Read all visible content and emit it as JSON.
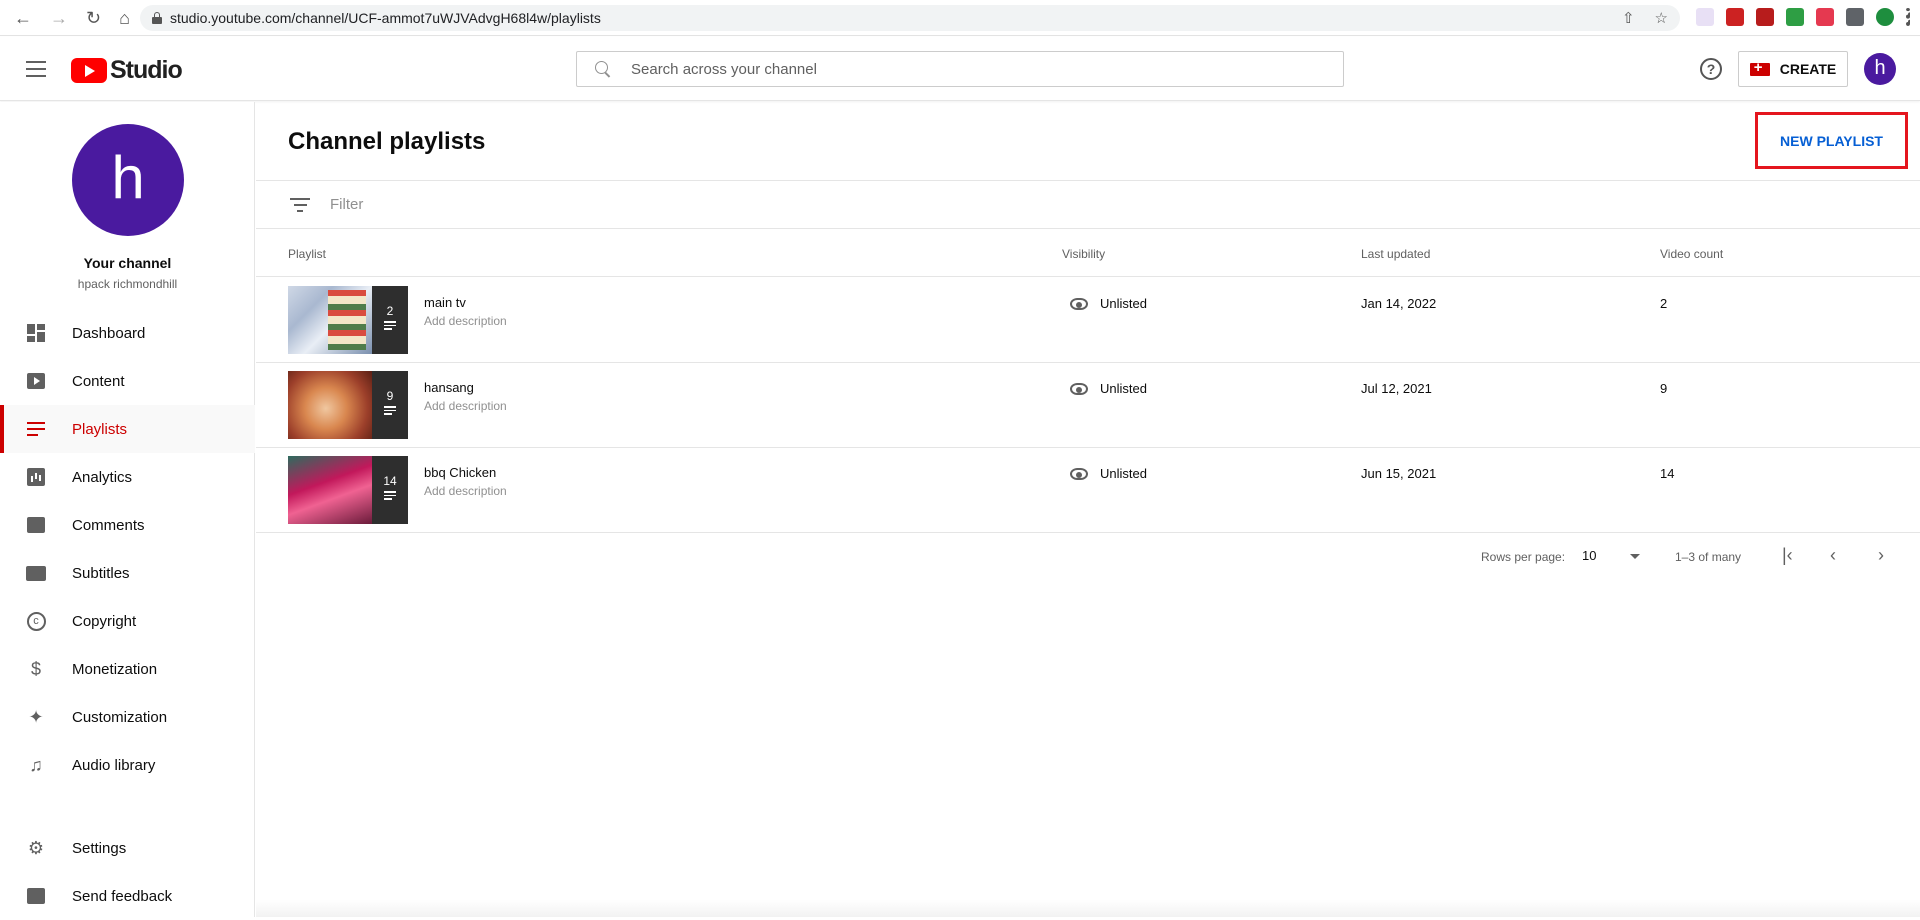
{
  "browser": {
    "url": "studio.youtube.com/channel/UCF-ammot7uWJVAdvgH68l4w/playlists"
  },
  "header": {
    "logo_text": "Studio",
    "search_placeholder": "Search across your channel",
    "create_label": "CREATE",
    "avatar_letter": "h",
    "help_glyph": "?"
  },
  "sidebar": {
    "avatar_letter": "h",
    "channel_title": "Your channel",
    "channel_name": "hpack richmondhill",
    "items": [
      {
        "label": "Dashboard",
        "icon": "dashboard-icon"
      },
      {
        "label": "Content",
        "icon": "content-icon"
      },
      {
        "label": "Playlists",
        "icon": "playlists-icon",
        "active": true
      },
      {
        "label": "Analytics",
        "icon": "analytics-icon"
      },
      {
        "label": "Comments",
        "icon": "comments-icon"
      },
      {
        "label": "Subtitles",
        "icon": "subtitles-icon"
      },
      {
        "label": "Copyright",
        "icon": "copyright-icon"
      },
      {
        "label": "Monetization",
        "icon": "dollar-icon"
      },
      {
        "label": "Customization",
        "icon": "magic-wand-icon"
      },
      {
        "label": "Audio library",
        "icon": "audio-library-icon"
      }
    ],
    "footer_items": [
      {
        "label": "Settings",
        "icon": "gear-icon"
      },
      {
        "label": "Send feedback",
        "icon": "feedback-icon"
      }
    ]
  },
  "main": {
    "title": "Channel playlists",
    "new_playlist_label": "NEW PLAYLIST",
    "filter_placeholder": "Filter",
    "columns": [
      "Playlist",
      "Visibility",
      "Last updated",
      "Video count"
    ],
    "rows": [
      {
        "title": "main tv",
        "description": "Add description",
        "thumb_count": "2",
        "visibility": "Unlisted",
        "last_updated": "Jan 14, 2022",
        "video_count": "2"
      },
      {
        "title": "hansang",
        "description": "Add description",
        "thumb_count": "9",
        "visibility": "Unlisted",
        "last_updated": "Jul 12, 2021",
        "video_count": "9"
      },
      {
        "title": "bbq Chicken",
        "description": "Add description",
        "thumb_count": "14",
        "visibility": "Unlisted",
        "last_updated": "Jun 15, 2021",
        "video_count": "14"
      }
    ],
    "pagination": {
      "rows_per_page_label": "Rows per page:",
      "rows_per_page_value": "10",
      "range": "1–3 of many"
    }
  },
  "colors": {
    "accent_red": "#cc0000",
    "link_blue": "#065fd4",
    "avatar_purple": "#4a1a9f",
    "highlight_box": "#e4161e"
  }
}
